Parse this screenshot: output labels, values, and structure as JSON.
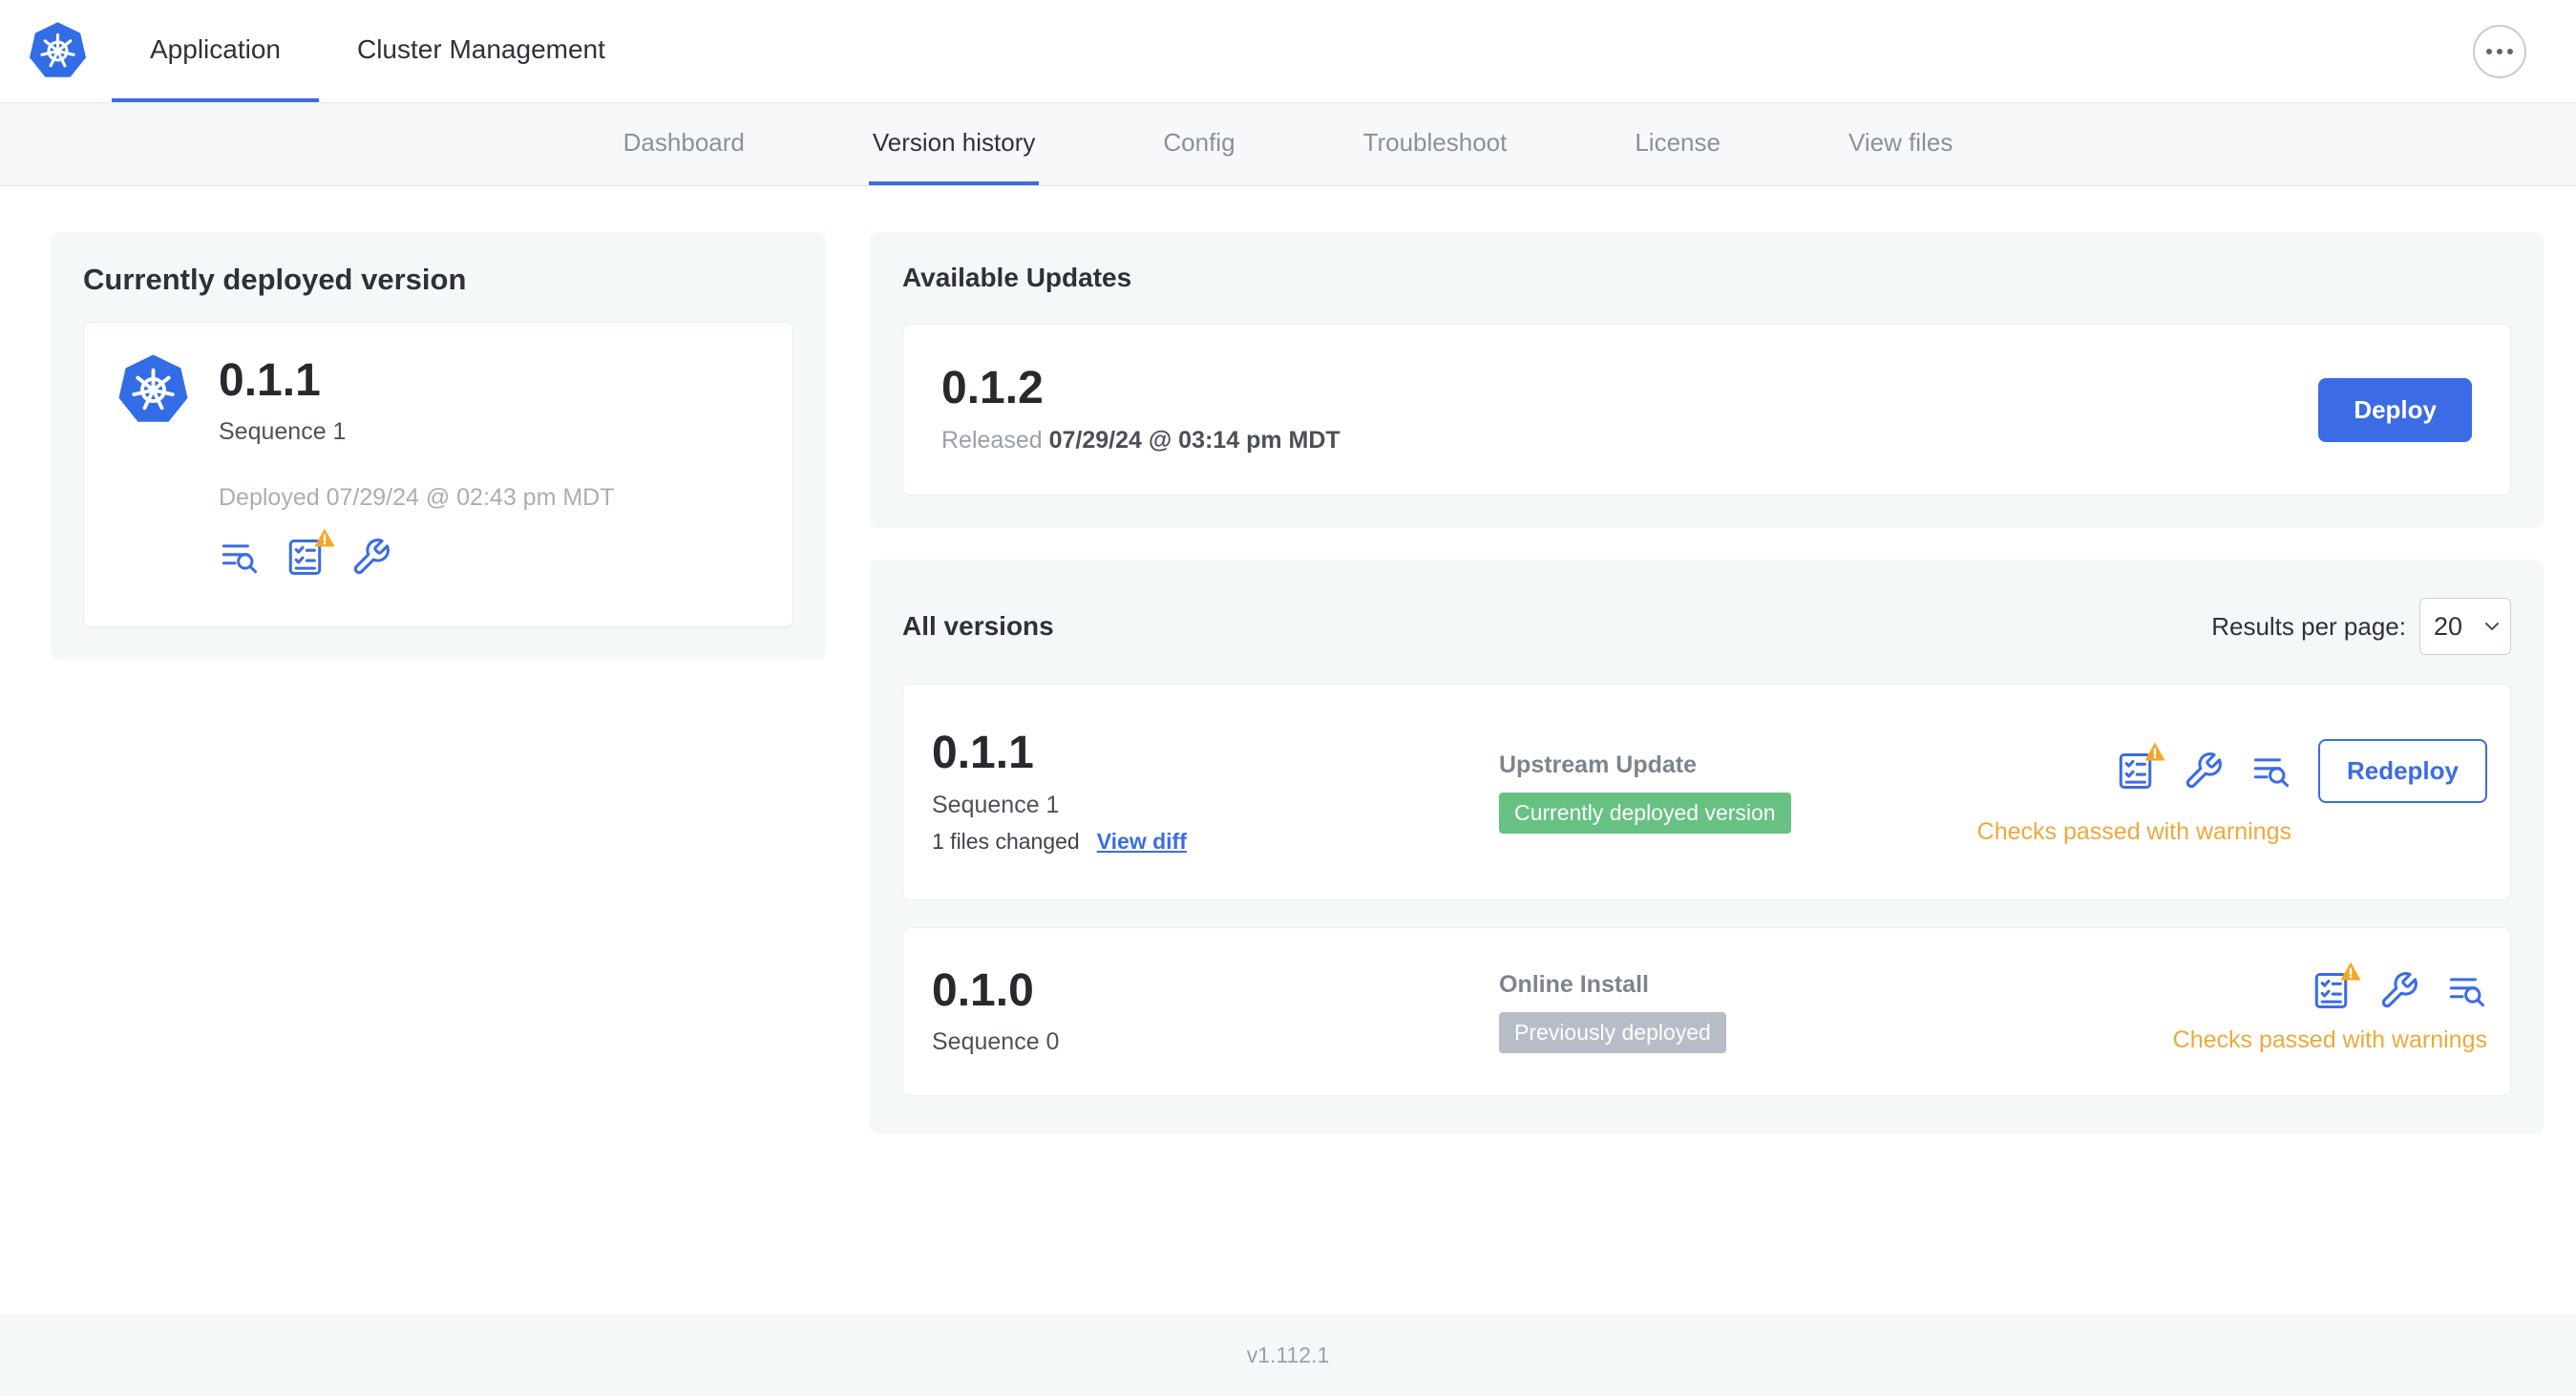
{
  "colors": {
    "accent_blue": "#3b6ce5",
    "kubernetes_blue": "#326de6",
    "warning_triangle": "#f5a623",
    "warning_text": "#eda93a",
    "badge_green": "#67c183",
    "badge_gray": "#b6bdc7"
  },
  "topnav": {
    "tabs": [
      {
        "label": "Application",
        "active": true
      },
      {
        "label": "Cluster Management",
        "active": false
      }
    ],
    "more_menu_icon": "ellipsis-icon"
  },
  "subnav": {
    "items": [
      {
        "label": "Dashboard",
        "active": false
      },
      {
        "label": "Version history",
        "active": true
      },
      {
        "label": "Config",
        "active": false
      },
      {
        "label": "Troubleshoot",
        "active": false
      },
      {
        "label": "License",
        "active": false
      },
      {
        "label": "View files",
        "active": false
      }
    ]
  },
  "current_version": {
    "title": "Currently deployed version",
    "version": "0.1.1",
    "sequence": "Sequence 1",
    "deployed": "Deployed 07/29/24 @ 02:43 pm MDT",
    "icons": [
      "deploy-logs-icon",
      "preflight-checks-warning-icon",
      "config-icon"
    ]
  },
  "available_updates": {
    "title": "Available Updates",
    "version": "0.1.2",
    "released_prefix": "Released",
    "released_date": "07/29/24 @ 03:14 pm MDT",
    "deploy_button": "Deploy"
  },
  "all_versions": {
    "title": "All versions",
    "results_per_page_label": "Results per page:",
    "results_per_page_value": "20",
    "rows": [
      {
        "version": "0.1.1",
        "sequence": "Sequence 1",
        "files_changed": "1 files changed",
        "view_diff": "View diff",
        "source": "Upstream Update",
        "badge": "Currently deployed version",
        "badge_color": "green",
        "checks_status": "Checks passed with warnings",
        "action_button": "Redeploy",
        "icons": [
          "preflight-checks-warning-icon",
          "config-icon",
          "deploy-logs-icon"
        ]
      },
      {
        "version": "0.1.0",
        "sequence": "Sequence 0",
        "source": "Online Install",
        "badge": "Previously deployed",
        "badge_color": "gray",
        "checks_status": "Checks passed with warnings",
        "icons": [
          "preflight-checks-warning-icon",
          "config-icon",
          "deploy-logs-icon"
        ]
      }
    ]
  },
  "footer": {
    "version": "v1.112.1"
  }
}
